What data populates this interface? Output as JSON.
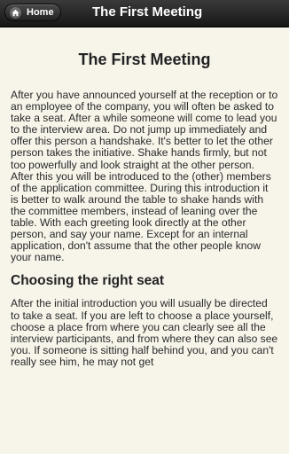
{
  "header": {
    "home_label": "Home",
    "title": "The First Meeting",
    "home_icon": "home-icon"
  },
  "article": {
    "title": "The First Meeting",
    "paragraph1": "After you have announced yourself at the reception or to an employee of the company, you will often be asked to take a seat. After a while someone will come to lead you to the interview area. Do not jump up immediately and offer this person a handshake. It's better to let the other person takes the initiative. Shake hands firmly, but not too powerfully and look straight at the other person. After this you will be introduced to the (other) members of the application committee. During this introduction it is better to walk around the table to shake hands with the committee members, instead of leaning over the table. With each greeting look directly at the other person, and say your name. Except for an internal application, don't assume that the other people know your name.",
    "subheading": "Choosing the right seat",
    "paragraph2": "After the initial introduction you will usually be directed to take a seat. If you are left to choose a place yourself, choose a place from where you can clearly see all the interview participants, and from where they can also see you. If someone is sitting half behind you, and you can't really see him, he may not get"
  }
}
